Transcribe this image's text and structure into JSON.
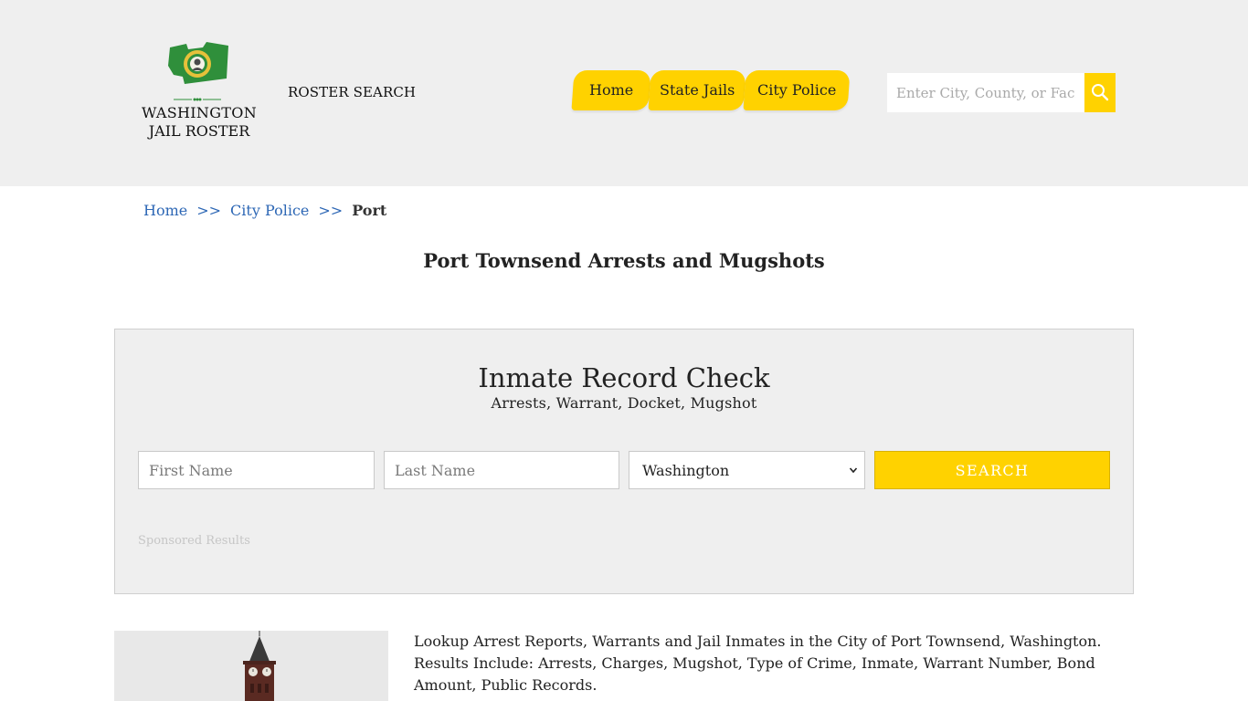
{
  "header": {
    "logo": {
      "line1": "WASHINGTON",
      "line2": "JAIL ROSTER"
    },
    "roster_search_label": "ROSTER SEARCH",
    "nav": [
      {
        "label": "Home"
      },
      {
        "label": "State Jails"
      },
      {
        "label": "City Police"
      }
    ],
    "search": {
      "placeholder": "Enter City, County, or Facility"
    },
    "accent_color": "#ffd200"
  },
  "breadcrumb": {
    "items": [
      {
        "label": "Home"
      },
      {
        "label": "City Police"
      }
    ],
    "separator": ">>",
    "current": "Port"
  },
  "page_title": "Port Townsend Arrests and Mugshots",
  "record_check": {
    "title": "Inmate Record Check",
    "subtitle": "Arrests, Warrant, Docket, Mugshot",
    "first_name_placeholder": "First Name",
    "last_name_placeholder": "Last Name",
    "state_selected": "Washington",
    "search_label": "SEARCH",
    "sponsored_label": "Sponsored Results"
  },
  "content": {
    "description": "Lookup Arrest Reports, Warrants and Jail Inmates in the City of Port Townsend, Washington. Results Include: Arrests, Charges, Mugshot, Type of Crime, Inmate, Warrant Number, Bond Amount, Public Records."
  }
}
